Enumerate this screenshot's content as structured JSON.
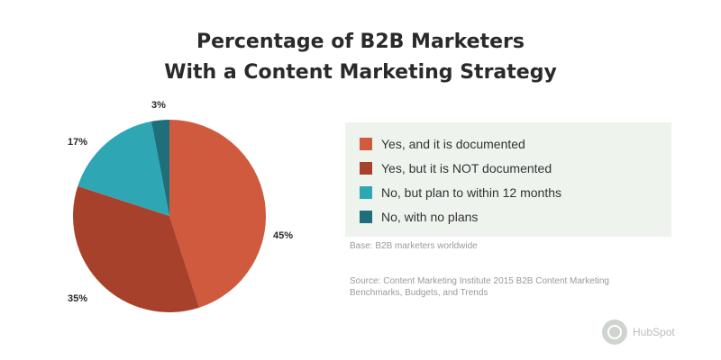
{
  "title_lines": [
    "Percentage of B2B Marketers",
    "With a Content Marketing Strategy"
  ],
  "colors": {
    "yes_documented": "#cf5a3e",
    "yes_not_documented": "#a8412c",
    "no_plan": "#2ea6b4",
    "no_no_plans": "#1f6f7b"
  },
  "chart_data": {
    "type": "pie",
    "title": "Percentage of B2B Marketers With a Content Marketing Strategy",
    "slices": [
      {
        "label": "Yes, and it is documented",
        "value": 45,
        "value_label": "45%",
        "color": "#cf5a3e"
      },
      {
        "label": "Yes, but it is NOT documented",
        "value": 35,
        "value_label": "35%",
        "color": "#a8412c"
      },
      {
        "label": "No, but plan to within 12 months",
        "value": 17,
        "value_label": "17%",
        "color": "#2ea6b4"
      },
      {
        "label": "No, with no plans",
        "value": 3,
        "value_label": "3%",
        "color": "#1f6f7b"
      }
    ],
    "legend_position": "right"
  },
  "notes": {
    "line1": "Base: B2B marketers worldwide",
    "line2": "Source: Content Marketing Institute 2015 B2B Content Marketing Benchmarks, Budgets, and Trends"
  },
  "brand": {
    "name": "HubSpot",
    "icon": "brand-logo-icon"
  }
}
